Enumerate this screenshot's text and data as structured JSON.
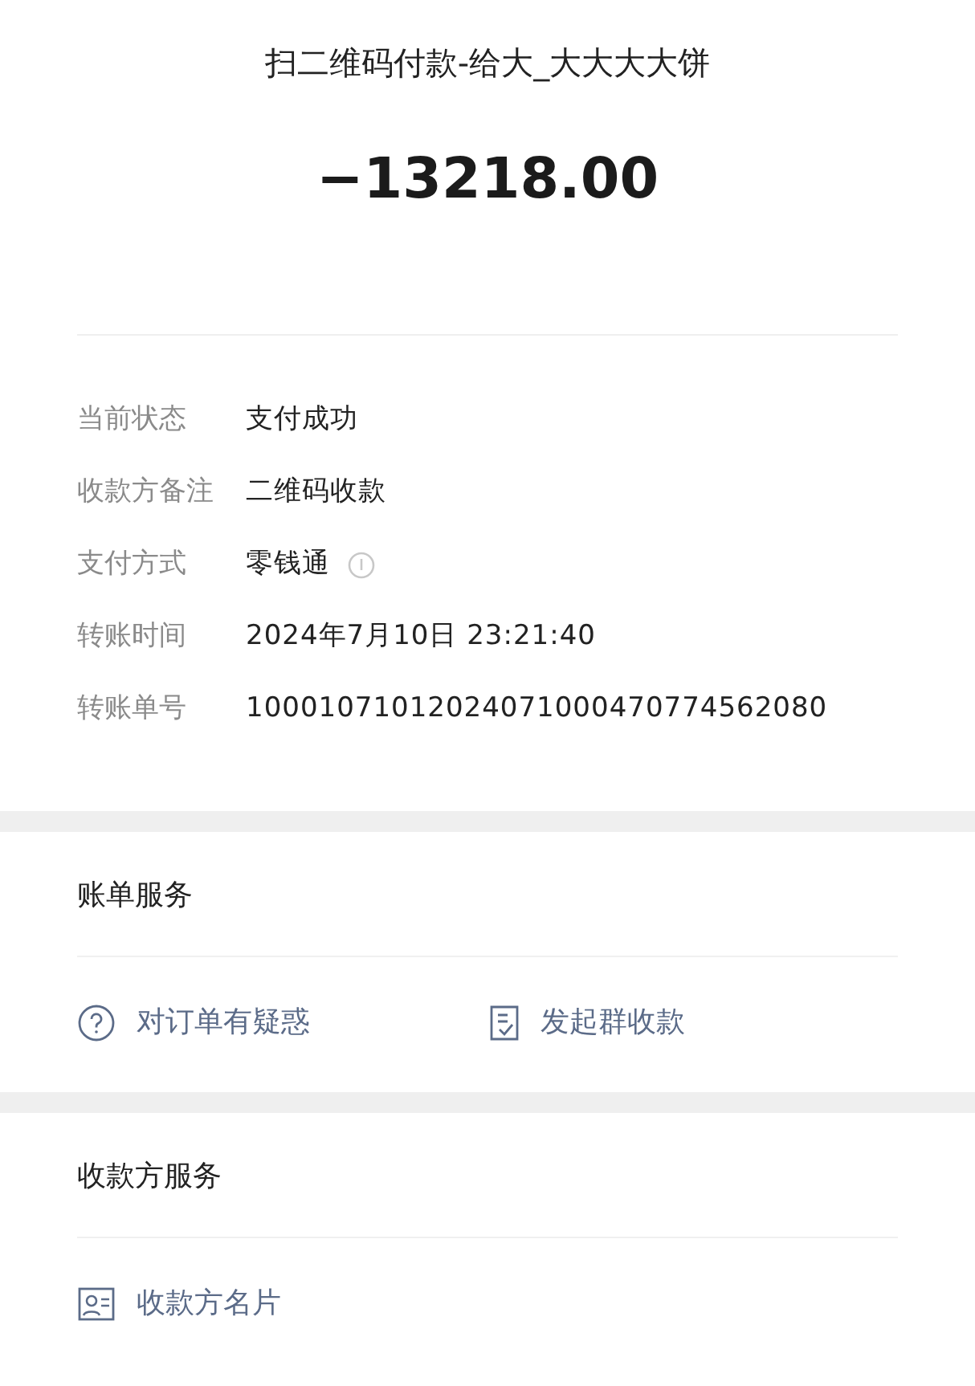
{
  "title": "扫二维码付款-给大_大大大大饼",
  "amount": "−13218.00",
  "details": [
    {
      "label": "当前状态",
      "value": "支付成功",
      "info": false
    },
    {
      "label": "收款方备注",
      "value": "二维码收款",
      "info": false
    },
    {
      "label": "支付方式",
      "value": "零钱通",
      "info": true
    },
    {
      "label": "转账时间",
      "value": "2024年7月10日 23:21:40",
      "info": false
    },
    {
      "label": "转账单号",
      "value": "10001071012024071000470774562080",
      "info": false
    }
  ],
  "sections": [
    {
      "title": "账单服务",
      "actions": [
        {
          "kind": "question",
          "label": "对订单有疑惑"
        },
        {
          "kind": "document",
          "label": "发起群收款"
        }
      ]
    },
    {
      "title": "收款方服务",
      "actions": [
        {
          "kind": "card",
          "label": "收款方名片"
        }
      ]
    }
  ]
}
